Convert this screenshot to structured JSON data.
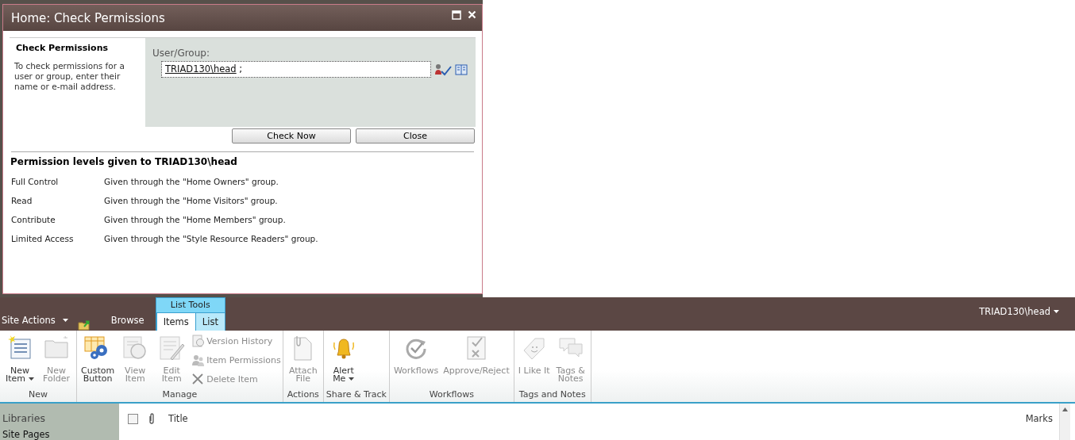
{
  "dialog": {
    "title": "Home: Check Permissions",
    "section_title": "Check Permissions",
    "section_description": "To check permissions for a user or group, enter their name or e-mail address.",
    "field_label": "User/Group:",
    "field_value": "TRIAD130\\head",
    "field_separator": ";",
    "buttons": [
      "Check Now",
      "Close"
    ],
    "results_heading": "Permission levels given to TRIAD130\\head",
    "permissions": [
      {
        "level": "Full Control",
        "source": "Given through the \"Home Owners\" group."
      },
      {
        "level": "Read",
        "source": "Given through the \"Home Visitors\" group."
      },
      {
        "level": "Contribute",
        "source": "Given through the \"Home Members\" group."
      },
      {
        "level": "Limited Access",
        "source": "Given through the \"Style Resource Readers\" group."
      }
    ]
  },
  "top_bar": {
    "site_actions": "Site Actions",
    "context_group": "List Tools",
    "tabs": [
      {
        "label": "Browse",
        "selected": false,
        "kind": "plain"
      },
      {
        "label": "Items",
        "selected": true,
        "kind": "contextual"
      },
      {
        "label": "List",
        "selected": false,
        "kind": "contextual"
      }
    ],
    "user": "TRIAD130\\head"
  },
  "ribbon": {
    "groups": [
      {
        "label": "New",
        "items": [
          {
            "kind": "large",
            "label": "New Item",
            "dropdown": true,
            "disabled": false
          },
          {
            "kind": "large",
            "label": "New Folder",
            "disabled": true
          }
        ]
      },
      {
        "label": "Manage",
        "items": [
          {
            "kind": "large",
            "label": "Custom Button",
            "disabled": false
          },
          {
            "kind": "large",
            "label": "View Item",
            "disabled": true
          },
          {
            "kind": "large",
            "label": "Edit Item",
            "disabled": true
          },
          {
            "kind": "small",
            "label": "Version History",
            "disabled": true
          },
          {
            "kind": "small",
            "label": "Item Permissions",
            "disabled": true
          },
          {
            "kind": "small",
            "label": "Delete Item",
            "disabled": true
          }
        ]
      },
      {
        "label": "Actions",
        "items": [
          {
            "kind": "large",
            "label": "Attach File",
            "disabled": true
          }
        ]
      },
      {
        "label": "Share & Track",
        "items": [
          {
            "kind": "large",
            "label": "Alert Me",
            "dropdown": true,
            "disabled": false
          }
        ]
      },
      {
        "label": "Workflows",
        "items": [
          {
            "kind": "large",
            "label": "Workflows",
            "disabled": true
          },
          {
            "kind": "large",
            "label": "Approve/Reject",
            "disabled": true
          }
        ]
      },
      {
        "label": "Tags and Notes",
        "items": [
          {
            "kind": "large",
            "label": "I Like It",
            "disabled": true
          },
          {
            "kind": "large",
            "label": "Tags & Notes",
            "disabled": true
          }
        ]
      }
    ]
  },
  "sidebar": {
    "heading": "Libraries",
    "items": [
      "Site Pages"
    ]
  },
  "list": {
    "select_all_checked": false,
    "columns": [
      "Title",
      "Marks"
    ]
  }
}
